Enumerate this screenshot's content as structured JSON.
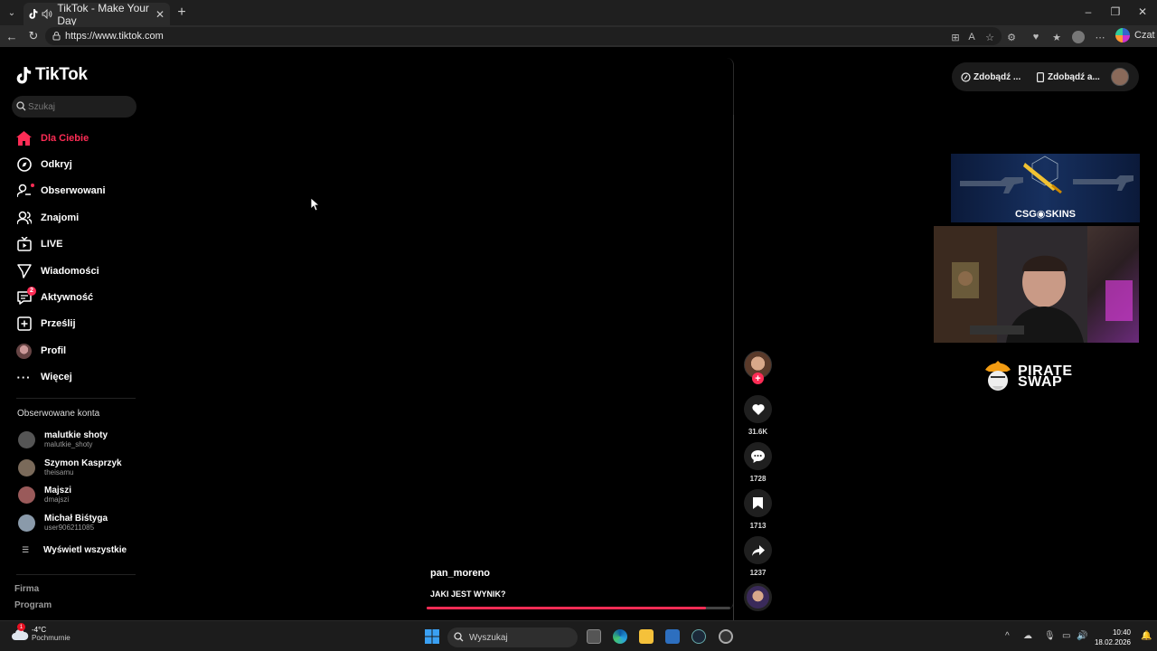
{
  "browser": {
    "tab_title": "TikTok - Make Your Day",
    "url": "https://www.tiktok.com",
    "copilot_label": "Czat"
  },
  "sidebar": {
    "brand": "TikTok",
    "search_placeholder": "Szukaj",
    "nav": [
      {
        "label": "Dla Ciebie",
        "icon": "home-icon",
        "active": true
      },
      {
        "label": "Odkryj",
        "icon": "compass-icon"
      },
      {
        "label": "Obserwowani",
        "icon": "following-icon"
      },
      {
        "label": "Znajomi",
        "icon": "friends-icon"
      },
      {
        "label": "LIVE",
        "icon": "live-icon"
      },
      {
        "label": "Wiadomości",
        "icon": "messages-icon"
      },
      {
        "label": "Aktywność",
        "icon": "activity-icon",
        "badge": "2"
      },
      {
        "label": "Prześlij",
        "icon": "upload-icon"
      },
      {
        "label": "Profil",
        "icon": "profile-avatar"
      },
      {
        "label": "Więcej",
        "icon": "more-icon"
      }
    ],
    "followed_title": "Obserwowane konta",
    "followed": [
      {
        "name": "malutkie shoty",
        "handle": "malutkie_shoty",
        "color": "#555555"
      },
      {
        "name": "Szymon Kasprzyk",
        "handle": "theisamu",
        "color": "#7a6a5a"
      },
      {
        "name": "Majszi",
        "handle": "dmajszi",
        "color": "#9a5a5a"
      },
      {
        "name": "Michał Biśtyga",
        "handle": "user906211085",
        "color": "#8a9aaa"
      }
    ],
    "show_all": "Wyświetl wszystkie",
    "footer": [
      "Firma",
      "Program"
    ]
  },
  "video": {
    "author": "pan_moreno",
    "caption": "JAKI JEST WYNIK?",
    "progress": 0.92
  },
  "actions": {
    "likes": "31.6K",
    "comments": "1728",
    "saves": "1713",
    "shares": "1237"
  },
  "top_right": {
    "btn1": "Zdobądź ...",
    "btn2": "Zdobądź a..."
  },
  "overlay": {
    "csgo_text": "CSG◉SKINS",
    "pirate_line1": "PIRATE",
    "pirate_line2": "SWAP"
  },
  "taskbar": {
    "temp": "-4°C",
    "weather": "Pochmurnie",
    "weather_badge": "1",
    "search": "Wyszukaj",
    "time": "10:40",
    "date": "18.02.2026"
  },
  "colors": {
    "accent": "#fe2c55",
    "page_bg": "#000000",
    "chrome_bg": "#1f1f1f"
  }
}
